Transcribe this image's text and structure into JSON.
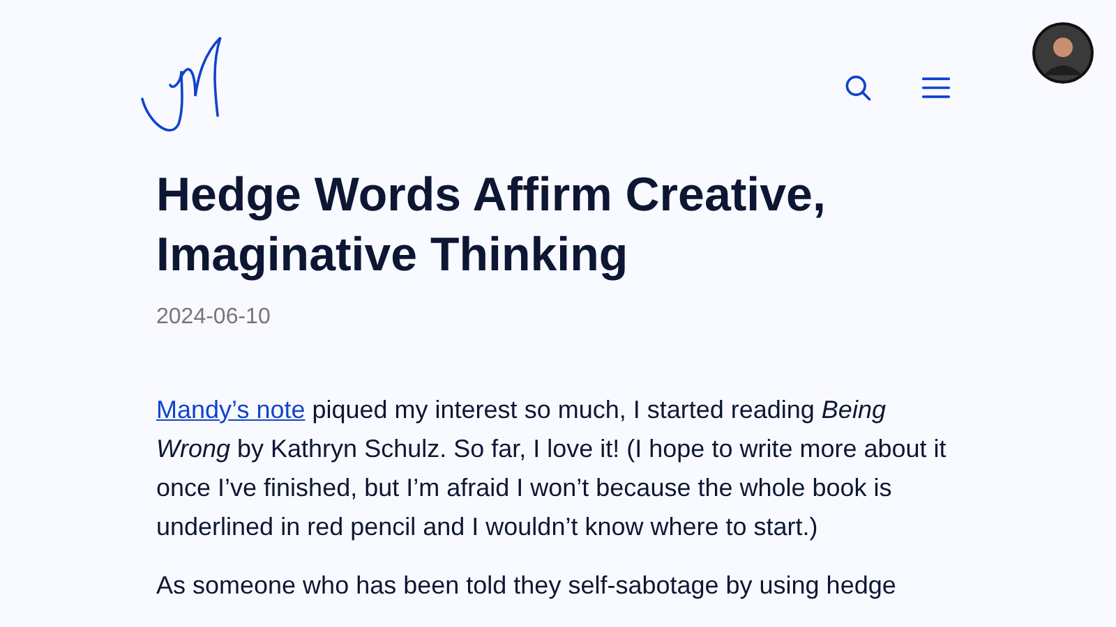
{
  "article": {
    "title": "Hedge Words Affirm Creative, Imaginative Thinking",
    "date": "2024-06-10",
    "paragraphs": [
      {
        "link": "Mandy’s note",
        "text": " piqued my interest so much, I started reading *Being Wrong* by Kathryn Schulz. So far, I love it! (I hope to write more about it once I’ve finished, but I’m afraid I won’t because the whole book is underlined in red pencil and I wouldn’t know where to start.)"
      },
      {
        "text": "As someone who has been told they self-sabotage by using hedge"
      }
    ]
  }
}
